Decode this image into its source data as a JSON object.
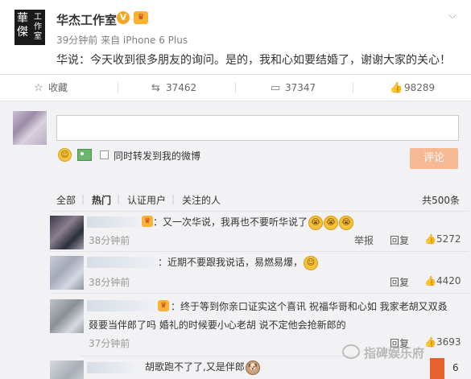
{
  "post": {
    "author": "华杰工作室",
    "verified_badge": "V",
    "meta": "39分钟前 来自 iPhone 6 Plus",
    "text": "华说：今天收到很多朋友的询问。是的，我和心如要结婚了，谢谢大家的关心！",
    "logo_big": "華傑",
    "logo_small": "工作室"
  },
  "actions": {
    "favorite": "收藏",
    "repost_count": "37462",
    "comment_count": "37347",
    "like_count": "98289"
  },
  "composer": {
    "repost_label": "同时转发到我的微博",
    "submit_label": "评论"
  },
  "filters": {
    "all": "全部",
    "hot": "热门",
    "verified": "认证用户",
    "following": "关注的人",
    "total": "共500条"
  },
  "comments": [
    {
      "text": "：又一次华说，我再也不要听华说了",
      "time": "38分钟前",
      "report": "举报",
      "reply": "回复",
      "likes": "5272"
    },
    {
      "text": "：近期不要跟我说话，易燃易爆，",
      "time": "38分钟前",
      "reply": "回复",
      "likes": "4420"
    },
    {
      "text_line1": "：终于等到你亲口证实这个喜讯  祝福华哥和心如   我家老胡又双叒",
      "text_line2": "叕要当伴郎了吗  婚礼的时候要小心老胡  说不定他会抢新郎的",
      "time": "37分钟前",
      "reply": "回复",
      "likes": "3693"
    },
    {
      "text": "胡歌跑不了了,又是伴郎"
    }
  ],
  "watermark": "指碑娱乐府",
  "cut_text": "6"
}
